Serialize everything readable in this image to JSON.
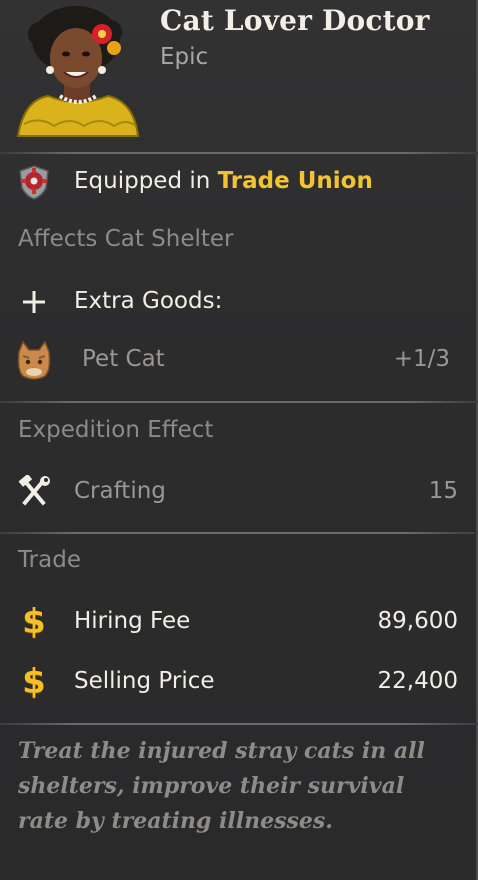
{
  "card": {
    "name": "Cat Lover Doctor",
    "rarity": "Epic"
  },
  "equipped": {
    "prefix": "Equipped in ",
    "location": "Trade Union",
    "icon": "gear-shield-icon"
  },
  "affects": {
    "title": "Affects Cat Shelter",
    "extra_goods_label": "Extra Goods:",
    "extra_goods_icon": "plus-icon",
    "items": [
      {
        "label": "Pet Cat",
        "value": "+1/3",
        "icon": "cat-icon"
      }
    ]
  },
  "expedition": {
    "title": "Expedition Effect",
    "items": [
      {
        "label": "Crafting",
        "value": "15",
        "icon": "hammer-wrench-icon"
      }
    ]
  },
  "trade": {
    "title": "Trade",
    "hiring_fee_label": "Hiring Fee",
    "hiring_fee_value": "89,600",
    "selling_price_label": "Selling Price",
    "selling_price_value": "22,400",
    "currency_symbol": "$"
  },
  "flavor": {
    "text": "Treat the injured stray cats in all shelters, improve their survival rate by treating illnesses."
  },
  "colors": {
    "accent_gold": "#f4c430",
    "background": "#2b2b2c",
    "dim_text": "#9a9895"
  }
}
